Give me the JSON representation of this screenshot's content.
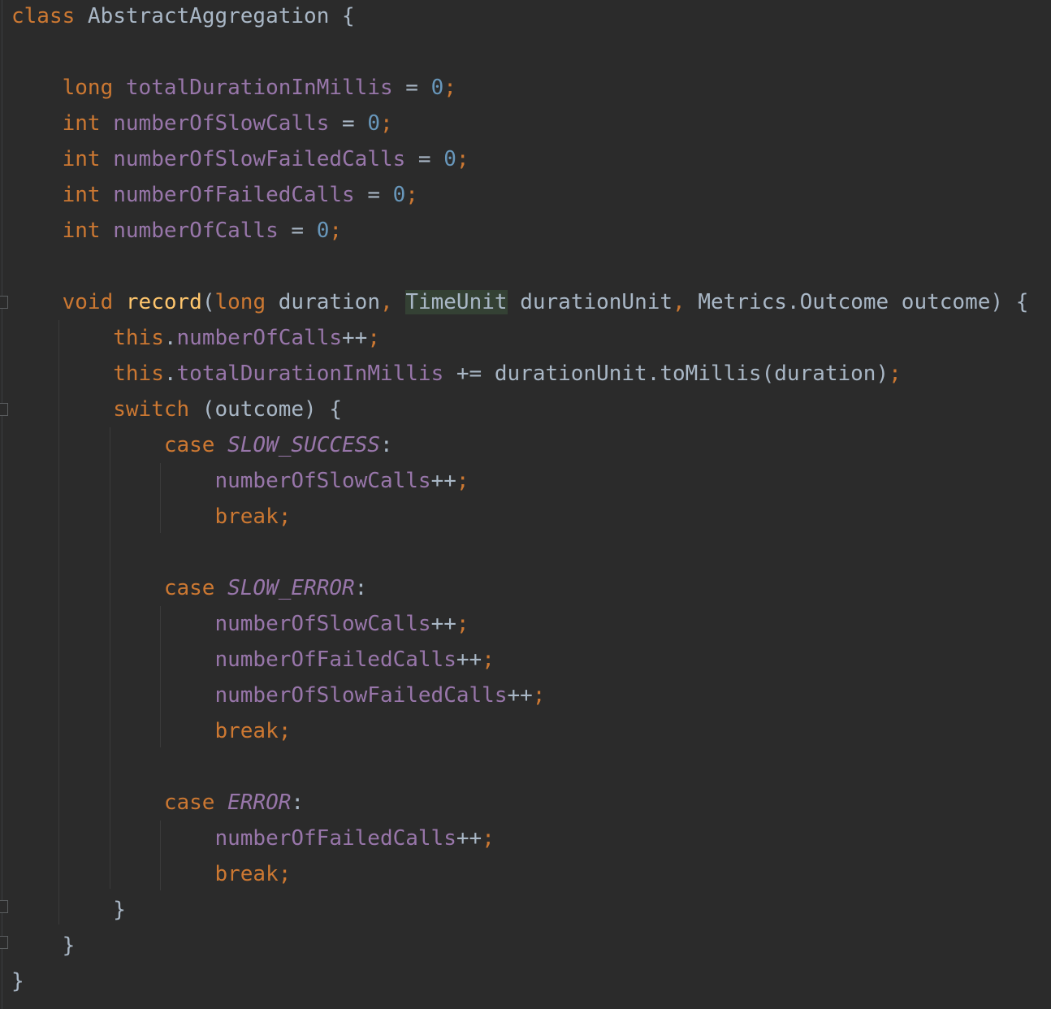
{
  "editor": {
    "lines": [
      [
        {
          "t": "class",
          "c": "kw"
        },
        {
          "t": " AbstractAggregation {"
        }
      ],
      [],
      [
        {
          "t": "    "
        },
        {
          "t": "long",
          "c": "kw"
        },
        {
          "t": " "
        },
        {
          "t": "totalDurationInMillis",
          "c": "fld"
        },
        {
          "t": " = "
        },
        {
          "t": "0",
          "c": "num"
        },
        {
          "t": ";",
          "c": "semi"
        }
      ],
      [
        {
          "t": "    "
        },
        {
          "t": "int",
          "c": "kw"
        },
        {
          "t": " "
        },
        {
          "t": "numberOfSlowCalls",
          "c": "fld"
        },
        {
          "t": " = "
        },
        {
          "t": "0",
          "c": "num"
        },
        {
          "t": ";",
          "c": "semi"
        }
      ],
      [
        {
          "t": "    "
        },
        {
          "t": "int",
          "c": "kw"
        },
        {
          "t": " "
        },
        {
          "t": "numberOfSlowFailedCalls",
          "c": "fld"
        },
        {
          "t": " = "
        },
        {
          "t": "0",
          "c": "num"
        },
        {
          "t": ";",
          "c": "semi"
        }
      ],
      [
        {
          "t": "    "
        },
        {
          "t": "int",
          "c": "kw"
        },
        {
          "t": " "
        },
        {
          "t": "numberOfFailedCalls",
          "c": "fld"
        },
        {
          "t": " = "
        },
        {
          "t": "0",
          "c": "num"
        },
        {
          "t": ";",
          "c": "semi"
        }
      ],
      [
        {
          "t": "    "
        },
        {
          "t": "int",
          "c": "kw"
        },
        {
          "t": " "
        },
        {
          "t": "numberOfCalls",
          "c": "fld"
        },
        {
          "t": " = "
        },
        {
          "t": "0",
          "c": "num"
        },
        {
          "t": ";",
          "c": "semi"
        }
      ],
      [],
      [
        {
          "t": "    "
        },
        {
          "t": "void",
          "c": "kw"
        },
        {
          "t": " "
        },
        {
          "t": "record",
          "c": "fn"
        },
        {
          "t": "("
        },
        {
          "t": "long",
          "c": "kw"
        },
        {
          "t": " duration"
        },
        {
          "t": ",",
          "c": "semi"
        },
        {
          "t": " "
        },
        {
          "t": "TimeUnit",
          "c": "hl"
        },
        {
          "t": " durationUnit"
        },
        {
          "t": ",",
          "c": "semi"
        },
        {
          "t": " Metrics.Outcome outcome) {"
        }
      ],
      [
        {
          "t": "        "
        },
        {
          "t": "this",
          "c": "kw"
        },
        {
          "t": "."
        },
        {
          "t": "numberOfCalls",
          "c": "fld"
        },
        {
          "t": "++"
        },
        {
          "t": ";",
          "c": "semi"
        }
      ],
      [
        {
          "t": "        "
        },
        {
          "t": "this",
          "c": "kw"
        },
        {
          "t": "."
        },
        {
          "t": "totalDurationInMillis",
          "c": "fld"
        },
        {
          "t": " += durationUnit.toMillis(duration)"
        },
        {
          "t": ";",
          "c": "semi"
        }
      ],
      [
        {
          "t": "        "
        },
        {
          "t": "switch",
          "c": "kw"
        },
        {
          "t": " (outcome) {"
        }
      ],
      [
        {
          "t": "            "
        },
        {
          "t": "case",
          "c": "kw"
        },
        {
          "t": " "
        },
        {
          "t": "SLOW_SUCCESS",
          "c": "enm"
        },
        {
          "t": ":"
        }
      ],
      [
        {
          "t": "                "
        },
        {
          "t": "numberOfSlowCalls",
          "c": "fld"
        },
        {
          "t": "++"
        },
        {
          "t": ";",
          "c": "semi"
        }
      ],
      [
        {
          "t": "                "
        },
        {
          "t": "break",
          "c": "kw"
        },
        {
          "t": ";",
          "c": "semi"
        }
      ],
      [],
      [
        {
          "t": "            "
        },
        {
          "t": "case",
          "c": "kw"
        },
        {
          "t": " "
        },
        {
          "t": "SLOW_ERROR",
          "c": "enm"
        },
        {
          "t": ":"
        }
      ],
      [
        {
          "t": "                "
        },
        {
          "t": "numberOfSlowCalls",
          "c": "fld"
        },
        {
          "t": "++"
        },
        {
          "t": ";",
          "c": "semi"
        }
      ],
      [
        {
          "t": "                "
        },
        {
          "t": "numberOfFailedCalls",
          "c": "fld"
        },
        {
          "t": "++"
        },
        {
          "t": ";",
          "c": "semi"
        }
      ],
      [
        {
          "t": "                "
        },
        {
          "t": "numberOfSlowFailedCalls",
          "c": "fld"
        },
        {
          "t": "++"
        },
        {
          "t": ";",
          "c": "semi"
        }
      ],
      [
        {
          "t": "                "
        },
        {
          "t": "break",
          "c": "kw"
        },
        {
          "t": ";",
          "c": "semi"
        }
      ],
      [],
      [
        {
          "t": "            "
        },
        {
          "t": "case",
          "c": "kw"
        },
        {
          "t": " "
        },
        {
          "t": "ERROR",
          "c": "enm"
        },
        {
          "t": ":"
        }
      ],
      [
        {
          "t": "                "
        },
        {
          "t": "numberOfFailedCalls",
          "c": "fld"
        },
        {
          "t": "++"
        },
        {
          "t": ";",
          "c": "semi"
        }
      ],
      [
        {
          "t": "                "
        },
        {
          "t": "break",
          "c": "kw"
        },
        {
          "t": ";",
          "c": "semi"
        }
      ],
      [
        {
          "t": "        }"
        }
      ],
      [
        {
          "t": "    }"
        }
      ],
      [
        {
          "t": "}"
        }
      ]
    ]
  },
  "colors": {
    "background": "#2b2b2b",
    "keyword": "#cc7832",
    "field": "#9876aa",
    "number": "#6897bb",
    "method": "#ffc66d",
    "plain": "#a9b7c6",
    "highlight": "#344134"
  }
}
